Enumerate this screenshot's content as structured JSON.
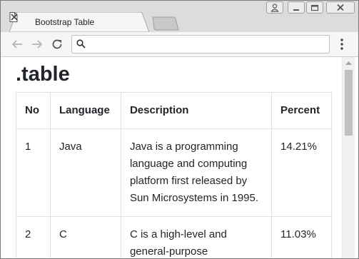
{
  "browser": {
    "tab_title": "Bootstrap Table",
    "address_value": "",
    "icons": {
      "page": "page-icon",
      "close": "close-icon",
      "back": "arrow-left-icon",
      "forward": "arrow-right-icon",
      "reload": "reload-icon",
      "search": "search-icon",
      "menu": "kebab-menu-icon",
      "user": "user-icon",
      "minimize": "minimize-icon",
      "restore": "restore-icon",
      "close_window": "close-window-icon"
    }
  },
  "page": {
    "heading": ".table",
    "table": {
      "headers": [
        "No",
        "Language",
        "Description",
        "Percent"
      ],
      "rows": [
        {
          "no": "1",
          "language": "Java",
          "description": "Java is a programming language and computing platform first released by Sun Microsystems in 1995.",
          "percent": "14.21%"
        },
        {
          "no": "2",
          "language": "C",
          "description": "C is a high-level and general-purpose",
          "percent": "11.03%"
        }
      ]
    }
  },
  "colors": {
    "tabstrip": "#dcdcdc",
    "toolbar": "#f6f6f6",
    "text": "#212529",
    "table_border": "#dee2e6",
    "scroll_thumb": "#c1c1c1"
  }
}
